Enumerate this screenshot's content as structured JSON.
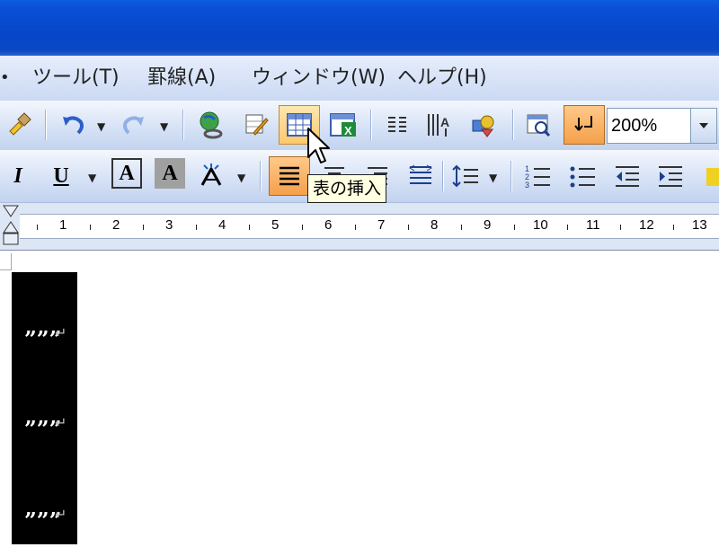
{
  "menu": {
    "items": [
      {
        "label": "ツール(T)"
      },
      {
        "label": "罫線(A)"
      },
      {
        "label": "ウィンドウ(W)"
      },
      {
        "label": "ヘルプ(H)"
      }
    ]
  },
  "toolbar": {
    "zoom_value": "200%",
    "tooltip": "表の挿入",
    "icons": [
      "format-painter-icon",
      "undo-icon",
      "redo-icon",
      "hyperlink-icon",
      "tables-borders-icon",
      "insert-table-icon",
      "insert-excel-icon",
      "columns-icon",
      "drawing-icon",
      "document-map-icon",
      "show-hide-icon"
    ]
  },
  "format_toolbar": {
    "italic": "I",
    "underline": "U",
    "char_border": "A",
    "char_shading": "A"
  },
  "ruler": {
    "numbers": [
      "1",
      "2",
      "3",
      "4",
      "5",
      "6",
      "7",
      "8",
      "9",
      "10",
      "11",
      "12",
      "13"
    ]
  },
  "document": {
    "lines": [
      "”””",
      "”””",
      "”””"
    ],
    "return_mark": "↵"
  },
  "colors": {
    "title_bar": "#0a50d8",
    "hot_button": "#f5a04a",
    "tooltip_bg": "#ffffe1"
  }
}
